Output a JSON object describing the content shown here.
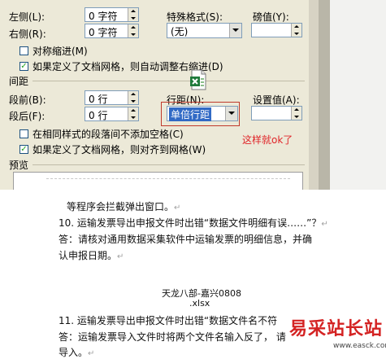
{
  "dialog": {
    "indent": {
      "left_label": "左侧(L):",
      "left_value": "0 字符",
      "right_label": "右侧(R):",
      "right_value": "0 字符",
      "special_label": "特殊格式(S):",
      "special_value": "(无)",
      "by_label": "磅值(Y):",
      "by_value": "",
      "mirror_label": "对称缩进(M)",
      "mirror_checked": false,
      "auto_adjust_label": "如果定义了文档网格，则自动调整右缩进(D)",
      "auto_adjust_checked": true
    },
    "spacing": {
      "section_title": "间距",
      "before_label": "段前(B):",
      "before_value": "0 行",
      "after_label": "段后(F):",
      "after_value": "0 行",
      "line_spacing_label": "行距(N):",
      "line_spacing_value": "单倍行距",
      "at_label": "设置值(A):",
      "at_value": "",
      "no_space_label": "在相同样式的段落间不添加空格(C)",
      "no_space_checked": false,
      "snap_grid_label": "如果定义了文档网格，则对齐到网格(W)",
      "snap_grid_checked": true
    },
    "annotation": "这样就ok了",
    "preview_title": "预览"
  },
  "document": {
    "line0": "等程序会拦截弹出窗口。",
    "q10": "10. 运输发票导出申报文件时出错“数据文件明细有误……”？",
    "a10_1": "答：请核对通用数据采集软件中运输发票的明细信息，并确",
    "a10_2": "认申报日期。",
    "attachment_name": "天龙八部-嘉兴0808",
    "attachment_ext": ".xlsx",
    "q11": "11. 运输发票导出申报文件时出错“数据文件名不符",
    "a11_1": "答：运输发票导入文件时将两个文件名输入反了，  请",
    "a11_2": "导入。",
    "paragraph_mark": "↵"
  },
  "watermark": {
    "text": "易采站长站",
    "url": "www.easck.com"
  },
  "colors": {
    "dialog_bg": "#ece9d8",
    "highlight_border": "#c0392b",
    "annotation": "#e0262a",
    "selected_bg": "#316ac5",
    "watermark": "#d42323"
  },
  "icons": {
    "excel": "excel-file-icon",
    "checkbox": "checkbox-icon",
    "dropdown": "chevron-down-icon"
  }
}
